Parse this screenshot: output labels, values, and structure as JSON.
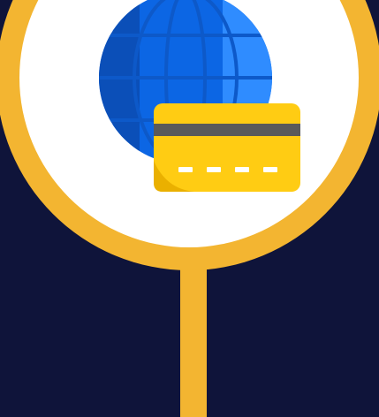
{
  "illustration": {
    "name": "global-payment-pin",
    "colors": {
      "background": "#0f143a",
      "pin_ring": "#f3b531",
      "pin_fill": "#ffffff",
      "globe_dark": "#0b4fb8",
      "globe_mid": "#0c66e4",
      "globe_light": "#2f8cff",
      "card_body": "#ffcc13",
      "card_stripe": "#5a5a5a",
      "card_shadow": "#eab000",
      "card_dots": "#ffffff"
    },
    "icons": [
      "globe-icon",
      "credit-card-icon",
      "location-pin-icon"
    ]
  }
}
